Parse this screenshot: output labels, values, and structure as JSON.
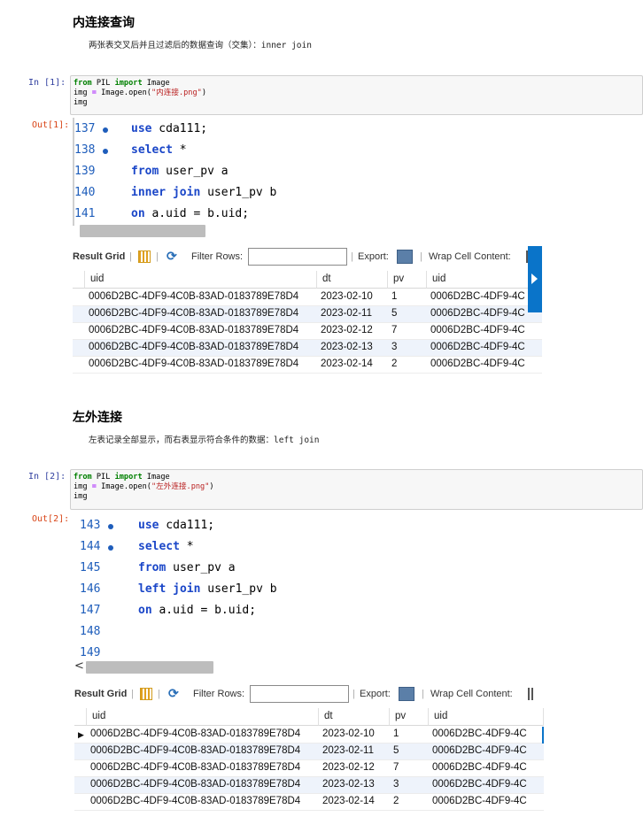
{
  "section1": {
    "heading": "内连接查询",
    "desc": "两张表交叉后并且过滤后的数据查询（交集）：inner join"
  },
  "cell1": {
    "in_prompt": "In  [1]:",
    "out_prompt": "Out[1]:",
    "code": {
      "line1": {
        "kw1": "from",
        "t1": " PIL ",
        "kw2": "import",
        "t2": " Image"
      },
      "line2": {
        "t1": "img ",
        "op": "=",
        "t2": " Image.open(",
        "str": "\"内连接.png\"",
        "t3": ")"
      },
      "line3": "img"
    }
  },
  "sql1": {
    "lines": [
      {
        "num": "137",
        "dot": true,
        "code_kw": "use",
        "code_rest": " cda111;"
      },
      {
        "num": "138",
        "dot": true,
        "code_kw": "select",
        "code_rest": " *"
      },
      {
        "num": "139",
        "dot": false,
        "code_kw": "from",
        "code_rest": " user_pv a"
      },
      {
        "num": "140",
        "dot": false,
        "code_kw": "inner join",
        "code_rest": " user1_pv b"
      },
      {
        "num": "141",
        "dot": false,
        "code_kw": "on",
        "code_rest": " a.uid = b.uid;"
      }
    ]
  },
  "section2": {
    "heading": "左外连接",
    "desc": "左表记录全部显示，而右表显示符合条件的数据：left join"
  },
  "cell2": {
    "in_prompt": "In  [2]:",
    "out_prompt": "Out[2]:",
    "code": {
      "line1": {
        "kw1": "from",
        "t1": " PIL ",
        "kw2": "import",
        "t2": " Image"
      },
      "line2": {
        "t1": "img ",
        "op": "=",
        "t2": " Image.open(",
        "str": "\"左外连接.png\"",
        "t3": ")"
      },
      "line3": "img"
    }
  },
  "sql2": {
    "lines": [
      {
        "num": "143",
        "dot": true,
        "code_kw": "use",
        "code_rest": " cda111;"
      },
      {
        "num": "144",
        "dot": true,
        "code_kw": "select",
        "code_rest": " *"
      },
      {
        "num": "145",
        "dot": false,
        "code_kw": "from",
        "code_rest": " user_pv a"
      },
      {
        "num": "146",
        "dot": false,
        "code_kw": "left join",
        "code_rest": " user1_pv b"
      },
      {
        "num": "147",
        "dot": false,
        "code_kw": "on",
        "code_rest": " a.uid = b.uid;"
      },
      {
        "num": "148",
        "dot": false,
        "code_kw": "",
        "code_rest": ""
      },
      {
        "num": "149",
        "dot": false,
        "code_kw": "",
        "code_rest": ""
      }
    ]
  },
  "grid": {
    "result_grid": "Result Grid",
    "filter_rows": "Filter Rows:",
    "export": "Export:",
    "wrap": "Wrap Cell Content:",
    "headers": [
      "uid",
      "dt",
      "pv",
      "uid"
    ],
    "rows": [
      [
        "0006D2BC-4DF9-4C0B-83AD-0183789E78D4",
        "2023-02-10",
        "1",
        "0006D2BC-4DF9-4C"
      ],
      [
        "0006D2BC-4DF9-4C0B-83AD-0183789E78D4",
        "2023-02-11",
        "5",
        "0006D2BC-4DF9-4C"
      ],
      [
        "0006D2BC-4DF9-4C0B-83AD-0183789E78D4",
        "2023-02-12",
        "7",
        "0006D2BC-4DF9-4C"
      ],
      [
        "0006D2BC-4DF9-4C0B-83AD-0183789E78D4",
        "2023-02-13",
        "3",
        "0006D2BC-4DF9-4C"
      ],
      [
        "0006D2BC-4DF9-4C0B-83AD-0183789E78D4",
        "2023-02-14",
        "2",
        "0006D2BC-4DF9-4C"
      ]
    ],
    "scroll_left_arrow": "<",
    "row_pointer": "▶"
  },
  "colors": {
    "accent": "#0a74c9",
    "sql_keyword": "#1a46c8",
    "line_number": "#1e5dbb"
  }
}
